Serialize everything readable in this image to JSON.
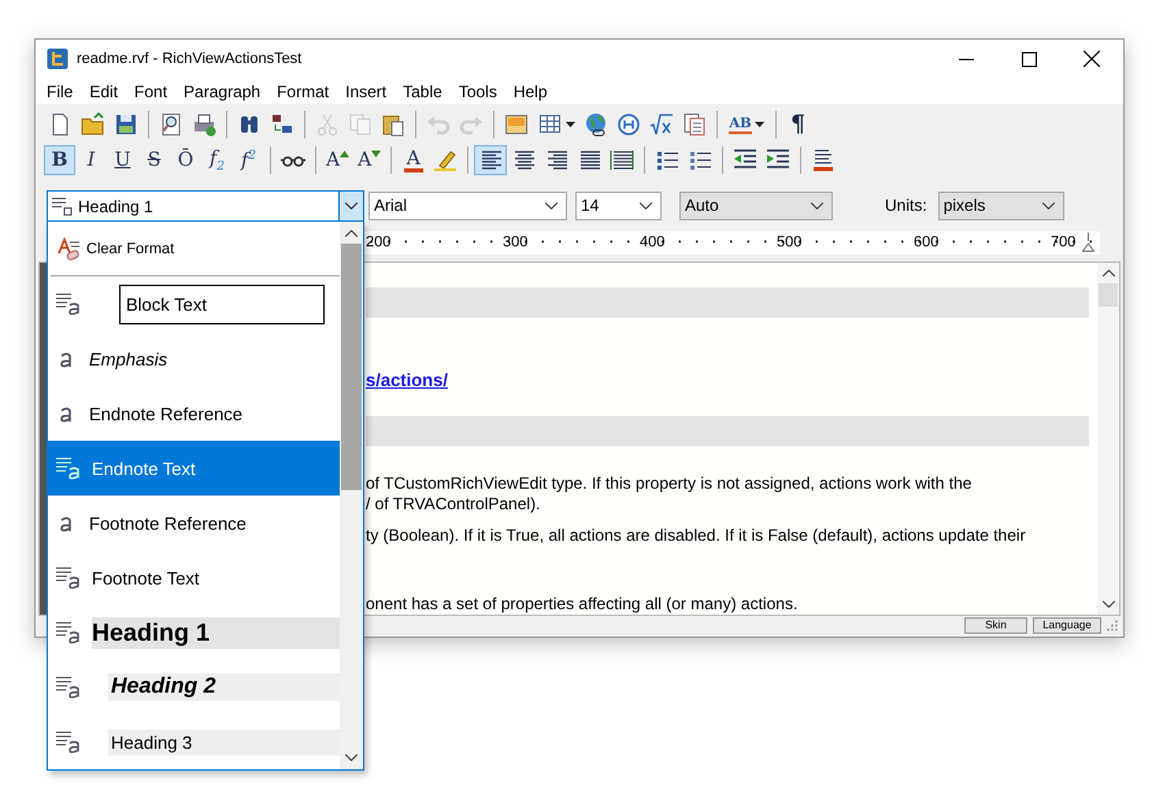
{
  "window": {
    "title": "readme.rvf - RichViewActionsTest"
  },
  "menu": [
    "File",
    "Edit",
    "Font",
    "Paragraph",
    "Format",
    "Insert",
    "Table",
    "Tools",
    "Help"
  ],
  "toolbar_1": [
    {
      "kind": "new",
      "disabled": false
    },
    {
      "kind": "open",
      "disabled": false
    },
    {
      "kind": "save",
      "disabled": false
    },
    {
      "kind": "separator"
    },
    {
      "kind": "preview",
      "disabled": false
    },
    {
      "kind": "print",
      "disabled": false
    },
    {
      "kind": "separator"
    },
    {
      "kind": "find",
      "disabled": false
    },
    {
      "kind": "replace",
      "disabled": false
    },
    {
      "kind": "separator"
    },
    {
      "kind": "cut",
      "disabled": true
    },
    {
      "kind": "copy",
      "disabled": true
    },
    {
      "kind": "paste",
      "disabled": false
    },
    {
      "kind": "separator"
    },
    {
      "kind": "undo",
      "disabled": true
    },
    {
      "kind": "redo",
      "disabled": true
    },
    {
      "kind": "separator"
    },
    {
      "kind": "image",
      "disabled": false
    },
    {
      "kind": "table",
      "disabled": false
    },
    {
      "kind": "hyperlink",
      "disabled": false
    },
    {
      "kind": "symbol",
      "disabled": false
    },
    {
      "kind": "equation",
      "disabled": false
    },
    {
      "kind": "document",
      "disabled": false
    },
    {
      "kind": "separator"
    },
    {
      "kind": "spelling",
      "glyph": "AB",
      "disabled": false
    },
    {
      "kind": "separator"
    },
    {
      "kind": "pilcrow",
      "glyph": "¶",
      "disabled": false
    }
  ],
  "toolbar_2": [
    {
      "kind": "letter",
      "glyph": "B",
      "selected": true
    },
    {
      "kind": "letter",
      "glyph": "I",
      "selected": false
    },
    {
      "kind": "letter",
      "glyph": "U",
      "selected": false
    },
    {
      "kind": "letter",
      "glyph": "S",
      "selected": false
    },
    {
      "kind": "letter",
      "glyph": "Ō",
      "selected": false
    },
    {
      "kind": "letter",
      "glyph": "f$_{2}$",
      "selected": false
    },
    {
      "kind": "letter",
      "glyph": "f$^{2}$",
      "selected": false
    },
    {
      "kind": "separator"
    },
    {
      "kind": "glasses",
      "selected": false
    },
    {
      "kind": "separator"
    },
    {
      "kind": "grow",
      "glyph": "A",
      "selected": false
    },
    {
      "kind": "shrink",
      "glyph": "A",
      "selected": false
    },
    {
      "kind": "separator"
    },
    {
      "kind": "fontcolor",
      "glyph": "A",
      "selected": false
    },
    {
      "kind": "highlight",
      "selected": false
    },
    {
      "kind": "separator"
    },
    {
      "kind": "alignleft",
      "selected": true
    },
    {
      "kind": "aligncenter",
      "selected": false
    },
    {
      "kind": "alignright",
      "selected": false
    },
    {
      "kind": "justify",
      "selected": false
    },
    {
      "kind": "distribute",
      "selected": false
    },
    {
      "kind": "separator"
    },
    {
      "kind": "bullets",
      "selected": false
    },
    {
      "kind": "numbering",
      "selected": false
    },
    {
      "kind": "separator"
    },
    {
      "kind": "outdent",
      "selected": false
    },
    {
      "kind": "indent",
      "selected": false
    },
    {
      "kind": "separator"
    },
    {
      "kind": "border",
      "selected": false
    }
  ],
  "style_combo": {
    "value": "Heading 1"
  },
  "font_combo": {
    "value": "Arial"
  },
  "size_combo": {
    "value": "14"
  },
  "color_combo": {
    "value": "Auto"
  },
  "units": {
    "label": "Units:",
    "value": "pixels"
  },
  "ruler": [
    "200",
    "300",
    "400",
    "500",
    "600",
    "700"
  ],
  "document": [
    {
      "kind": "band"
    },
    {
      "kind": "link",
      "text": "s/actions/"
    },
    {
      "kind": "band"
    },
    {
      "kind": "text",
      "text": "of TCustomRichViewEdit type. If this property is not assigned, actions work with the"
    },
    {
      "kind": "text",
      "text": "/ of TRVAControlPanel)."
    },
    {
      "kind": "text",
      "text": "ty (Boolean). If it is True, all actions are disabled. If it is False (default), actions update their"
    },
    {
      "kind": "gap"
    },
    {
      "kind": "text",
      "text": "onent has a set of properties affecting all (or many) actions."
    }
  ],
  "status_buttons": [
    "Skin",
    "Language"
  ],
  "style_list": [
    {
      "kind": "clear",
      "label": "Clear Format",
      "selected": false
    },
    {
      "kind": "boxed",
      "label": "Block Text",
      "selected": false
    },
    {
      "kind": "italic",
      "label": "Emphasis",
      "selected": false
    },
    {
      "kind": "charplain",
      "label": "Endnote Reference",
      "selected": false
    },
    {
      "kind": "plain",
      "label": "Endnote Text",
      "selected": true
    },
    {
      "kind": "charplain",
      "label": "Footnote Reference",
      "selected": false
    },
    {
      "kind": "plain",
      "label": "Footnote Text",
      "selected": false
    },
    {
      "kind": "h1",
      "label": "Heading 1",
      "selected": false
    },
    {
      "kind": "h2",
      "label": "Heading 2",
      "selected": false
    },
    {
      "kind": "h3",
      "label": "Heading 3",
      "selected": false
    }
  ]
}
